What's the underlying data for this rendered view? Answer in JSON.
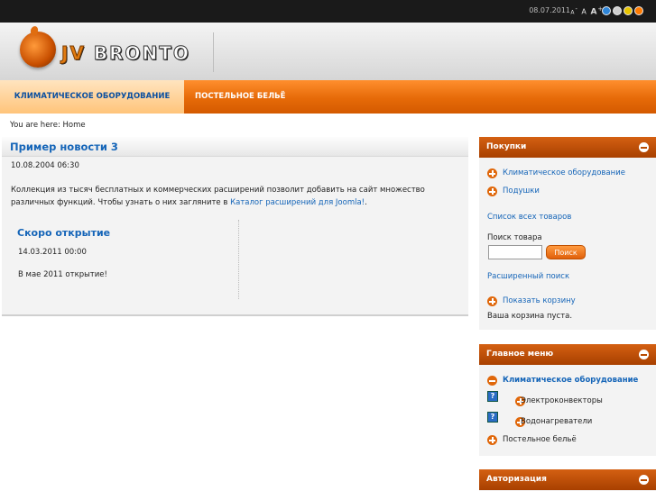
{
  "topbar": {
    "date": "08.07.2011",
    "font_small": "A",
    "font_mid": "A",
    "font_large": "A",
    "theme_colors": [
      "#2f86d9",
      "#cfcfcf",
      "#e8c400",
      "#ff7a00"
    ]
  },
  "header": {
    "logo_prefix": "JV",
    "logo_text": "BRONTO"
  },
  "nav": {
    "tabs": [
      {
        "label": "КЛИМАТИЧЕСКОЕ ОБОРУДОВАНИЕ",
        "active": true
      },
      {
        "label": "ПОСТЕЛЬНОЕ БЕЛЬЁ",
        "active": false
      }
    ]
  },
  "breadcrumb": "You are here: Home",
  "article": {
    "title": "Пример новости 3",
    "date": "10.08.2004 06:30",
    "text_before_link": "Коллекция из тысяч бесплатных и коммерческих расширений позволит добавить на сайт множество различных функций. Чтобы узнать о них загляните в ",
    "link_text": "Каталог расширений для Joomla!",
    "text_after_link": ".",
    "sub": {
      "title": "Скоро открытие",
      "date": "14.03.2011 00:00",
      "text": "В мае 2011 открытие!"
    }
  },
  "shop": {
    "title": "Покупки",
    "categories": [
      "Климатическое оборудование",
      "Подушки"
    ],
    "all_products": "Список всех товаров",
    "search_label": "Поиск товара",
    "search_value": "",
    "search_button": "Поиск",
    "advanced_search": "Расширенный поиск",
    "show_cart": "Показать корзину",
    "cart_status": "Ваша корзина пуста."
  },
  "main_menu": {
    "title": "Главное меню",
    "items": [
      "Климатическое оборудование",
      "Электроконвекторы",
      "Водонагреватели",
      "Постельное бельё"
    ]
  },
  "auth": {
    "title": "Авторизация"
  }
}
